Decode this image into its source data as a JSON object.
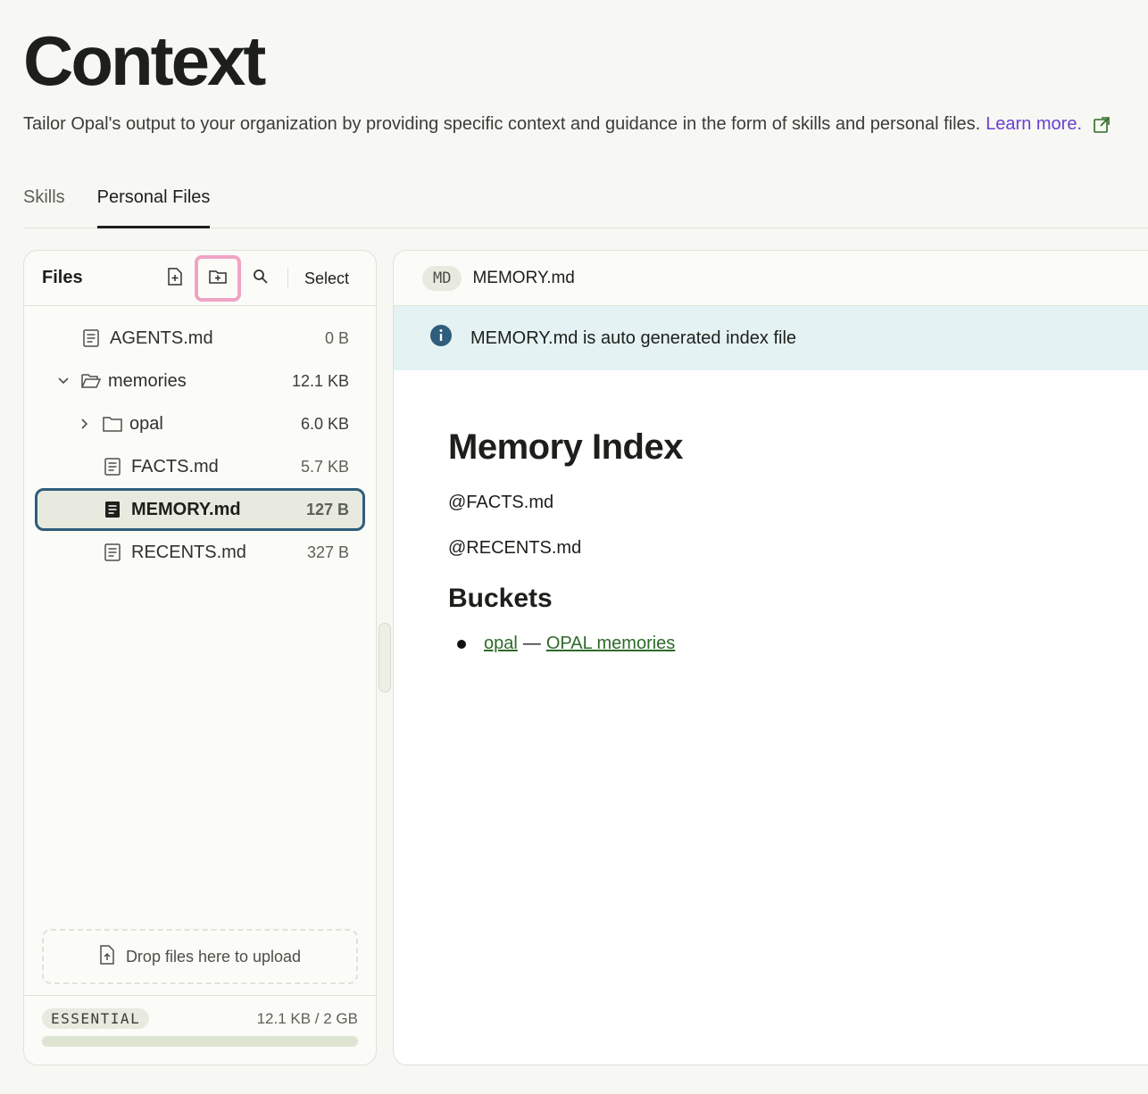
{
  "page": {
    "title": "Context",
    "subtitle": "Tailor Opal's output to your organization by providing specific context and guidance in the form of skills and personal files.",
    "learn_more": "Learn more."
  },
  "tabs": [
    {
      "label": "Skills",
      "active": false
    },
    {
      "label": "Personal Files",
      "active": true
    }
  ],
  "files_panel": {
    "title": "Files",
    "select_label": "Select",
    "tools": [
      "new-file-icon",
      "new-folder-icon",
      "search-icon"
    ],
    "tree": [
      {
        "name": "AGENTS.md",
        "size": "0 B",
        "type": "file",
        "depth": 0
      },
      {
        "name": "memories",
        "size": "12.1 KB",
        "type": "folder-open",
        "depth": 0,
        "expanded": true
      },
      {
        "name": "opal",
        "size": "6.0 KB",
        "type": "folder",
        "depth": 1,
        "expanded": false
      },
      {
        "name": "FACTS.md",
        "size": "5.7 KB",
        "type": "file",
        "depth": 1
      },
      {
        "name": "MEMORY.md",
        "size": "127 B",
        "type": "file",
        "depth": 1,
        "selected": true
      },
      {
        "name": "RECENTS.md",
        "size": "327 B",
        "type": "file",
        "depth": 1
      }
    ],
    "dropzone_label": "Drop files here to upload",
    "storage": {
      "plan": "ESSENTIAL",
      "usage": "12.1 KB / 2 GB",
      "fraction_used": 6e-06
    }
  },
  "viewer": {
    "badge": "MD",
    "filename": "MEMORY.md",
    "banner": "MEMORY.md is auto generated index file",
    "doc": {
      "h1": "Memory Index",
      "lines": [
        "@FACTS.md",
        "@RECENTS.md"
      ],
      "h2": "Buckets",
      "list": [
        {
          "link1": "opal",
          "sep": "—",
          "link2": "OPAL memories"
        }
      ]
    }
  },
  "colors": {
    "accent_link": "#6a3fd3",
    "selected_border": "#2f5d7c",
    "highlight": "#f0a3c4",
    "banner_bg": "#e4f2f3",
    "doc_link": "#2e6a2a"
  }
}
